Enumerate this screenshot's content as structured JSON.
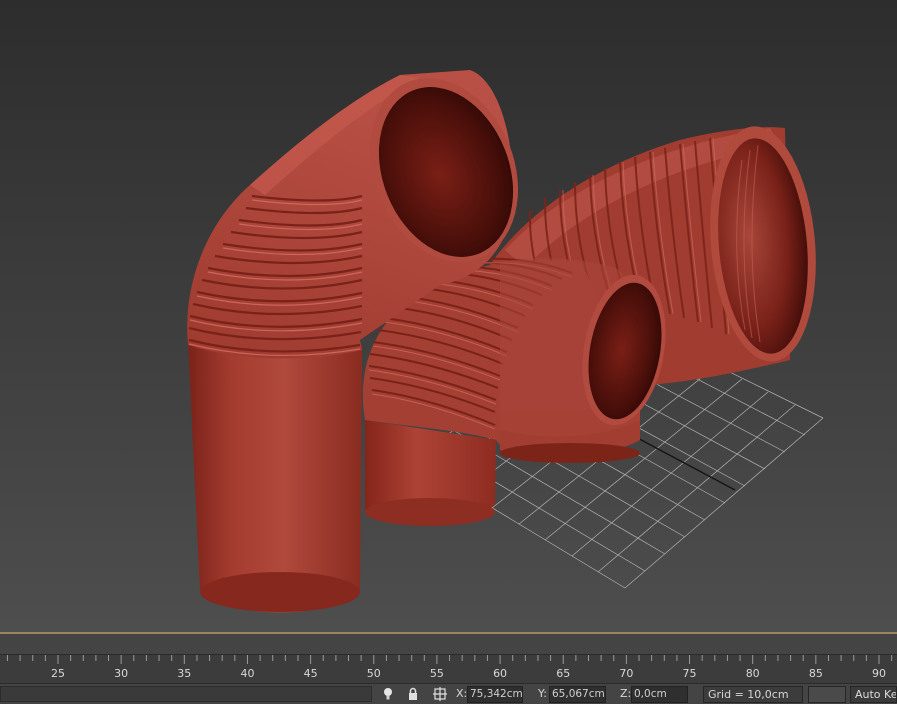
{
  "colors": {
    "viewport_bg_top": "#2e2e2e",
    "viewport_bg_bottom": "#4d4d4d",
    "pipe_red": "#b0463a",
    "pipe_dark": "#3e0c09",
    "grid_line": "#bcbcbc",
    "timeline_divider": "#9a8560"
  },
  "viewport": {
    "objects": [
      "elbow-pipe-left",
      "elbow-pipe-back",
      "elbow-pipe-front"
    ],
    "home_grid": "visible"
  },
  "timeline": {
    "ruler_labels": [
      "25",
      "30",
      "35",
      "40",
      "45",
      "50",
      "55",
      "60",
      "65",
      "70",
      "75",
      "80",
      "85",
      "90"
    ]
  },
  "status_bar": {
    "icons": [
      "lightbulb-icon",
      "lock-icon",
      "absolute-mode-transform-icon"
    ],
    "x_label": "X:",
    "x_value": "75,342cm",
    "y_label": "Y:",
    "y_value": "65,067cm",
    "z_label": "Z:",
    "z_value": "0,0cm",
    "grid": "Grid = 10,0cm",
    "auto_key": "Auto Key"
  }
}
